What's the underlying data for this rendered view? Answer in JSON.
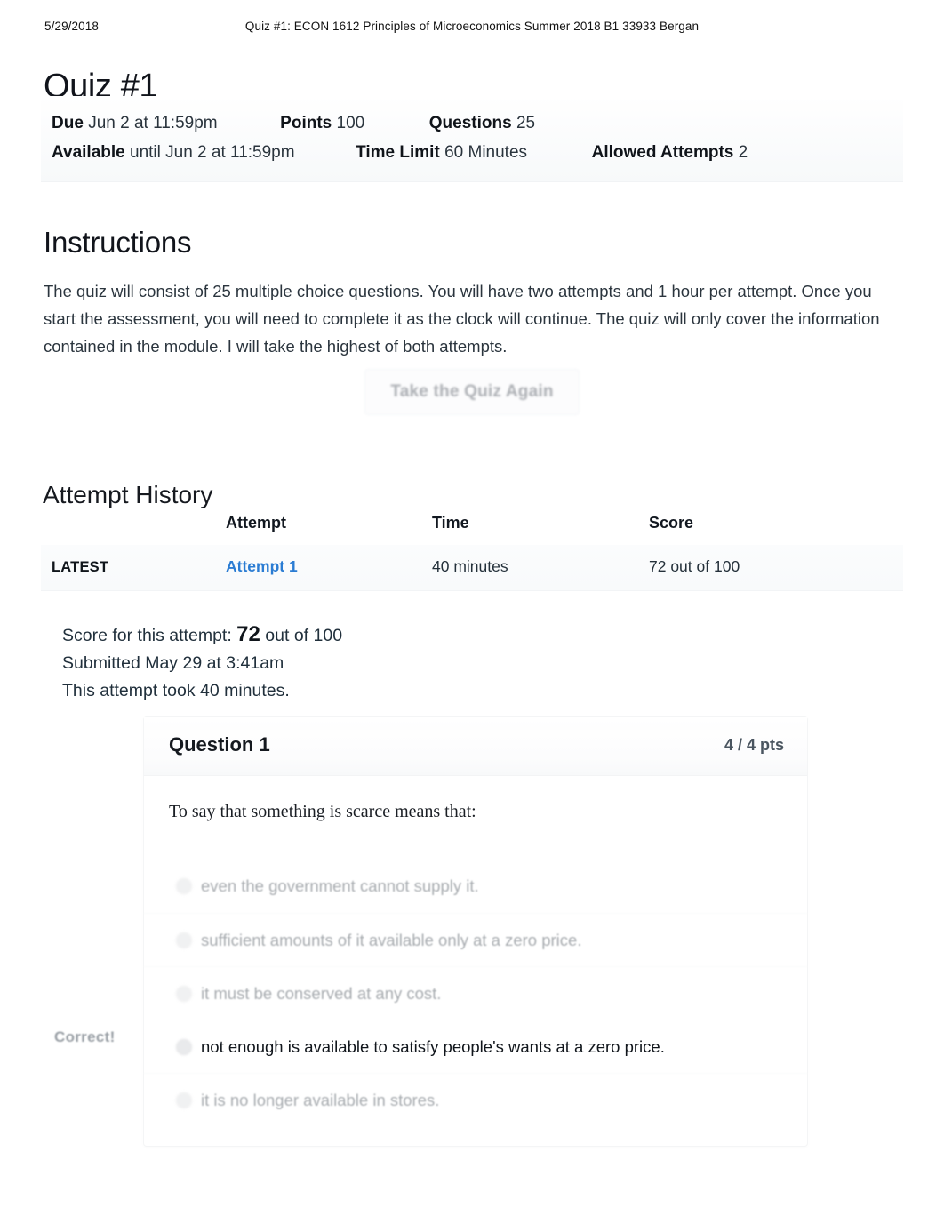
{
  "print_header": {
    "date": "5/29/2018",
    "title": "Quiz #1: ECON 1612 Principles of Microeconomics Summer 2018 B1 33933 Bergan"
  },
  "quiz": {
    "title": "Quiz #1",
    "details": {
      "due_label": "Due",
      "due_value": "Jun 2 at 11:59pm",
      "points_label": "Points",
      "points_value": "100",
      "questions_label": "Questions",
      "questions_value": "25",
      "available_label": "Available",
      "available_value": "until Jun 2 at 11:59pm",
      "time_limit_label": "Time Limit",
      "time_limit_value": "60 Minutes",
      "allowed_attempts_label": "Allowed Attempts",
      "allowed_attempts_value": "2"
    }
  },
  "instructions": {
    "heading": "Instructions",
    "body": "The quiz will consist of 25 multiple choice questions. You will have two attempts and 1 hour per attempt. Once you start the assessment, you will need to complete it as the clock will continue. The quiz will only cover the information contained in the module. I will take the highest of both attempts."
  },
  "actions": {
    "retake_label": "Take the Quiz Again"
  },
  "attempt_history": {
    "heading": "Attempt History",
    "columns": [
      "",
      "Attempt",
      "Time",
      "Score"
    ],
    "rows": [
      {
        "flag": "LATEST",
        "attempt": "Attempt 1",
        "time": "40 minutes",
        "score": "72 out of 100"
      }
    ]
  },
  "score_summary": {
    "score_prefix": "Score for this attempt:",
    "score_value": "72",
    "score_suffix": "out of 100",
    "submitted": "Submitted May 29 at 3:41am",
    "duration": "This attempt took 40 minutes."
  },
  "question": {
    "name": "Question 1",
    "points": "4 / 4 pts",
    "prompt": "To say that something is scarce means that:",
    "correct_flag": "Correct!",
    "answers": [
      {
        "text": "even the government cannot supply it.",
        "selected": false
      },
      {
        "text": "sufficient amounts of it available only at a zero price.",
        "selected": false
      },
      {
        "text": "it must be conserved at any cost.",
        "selected": false
      },
      {
        "text": "not enough is available to satisfy people's wants at a zero price.",
        "selected": true
      },
      {
        "text": "it is no longer available in stores.",
        "selected": false
      }
    ]
  },
  "colors": {
    "link_blue": "#2b7cd3",
    "text_dark": "#2d3b45",
    "muted_gray": "#a8acb0",
    "page_bg": "#ffffff"
  }
}
